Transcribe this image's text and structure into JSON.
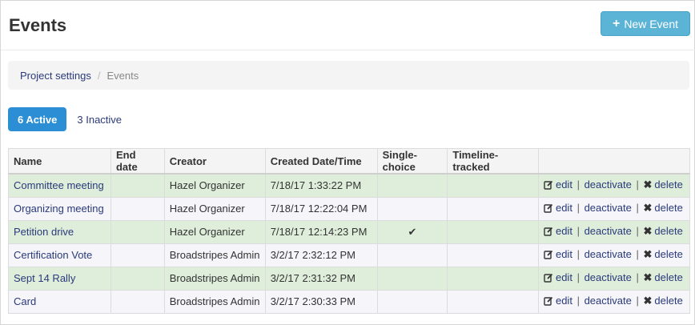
{
  "page": {
    "title": "Events"
  },
  "header": {
    "new_event_label": "New Event"
  },
  "breadcrumb": {
    "parent": "Project settings",
    "separator": "/",
    "current": "Events"
  },
  "tabs": {
    "active_label": "6 Active",
    "inactive_label": "3 Inactive"
  },
  "table": {
    "columns": [
      "Name",
      "End date",
      "Creator",
      "Created Date/Time",
      "Single-choice",
      "Timeline-tracked",
      ""
    ],
    "rows": [
      {
        "name": "Committee meeting",
        "end_date": "",
        "creator": "Hazel Organizer",
        "created": "7/18/17 1:33:22 PM",
        "single_choice": "",
        "timeline": ""
      },
      {
        "name": "Organizing meeting",
        "end_date": "",
        "creator": "Hazel Organizer",
        "created": "7/18/17 12:22:04 PM",
        "single_choice": "",
        "timeline": ""
      },
      {
        "name": "Petition drive",
        "end_date": "",
        "creator": "Hazel Organizer",
        "created": "7/18/17 12:14:23 PM",
        "single_choice": "✔",
        "timeline": ""
      },
      {
        "name": "Certification Vote",
        "end_date": "",
        "creator": "Broadstripes Admin",
        "created": "3/2/17 2:32:12 PM",
        "single_choice": "",
        "timeline": ""
      },
      {
        "name": "Sept 14 Rally",
        "end_date": "",
        "creator": "Broadstripes Admin",
        "created": "3/2/17 2:31:32 PM",
        "single_choice": "",
        "timeline": ""
      },
      {
        "name": "Card",
        "end_date": "",
        "creator": "Broadstripes Admin",
        "created": "3/2/17 2:30:33 PM",
        "single_choice": "",
        "timeline": ""
      }
    ],
    "actions": {
      "edit": "edit",
      "deactivate": "deactivate",
      "delete": "delete",
      "separator": "|"
    }
  },
  "colors": {
    "primary_tab": "#2c8fd6",
    "new_button": "#5bb3d6",
    "link": "#2a3a7a",
    "row_green": "#dfeedb",
    "row_lavender": "#f5f5fa"
  },
  "icons": {
    "new_event": "plus-icon",
    "edit": "edit-icon",
    "delete": "close-icon",
    "single_choice": "checkmark-icon"
  }
}
